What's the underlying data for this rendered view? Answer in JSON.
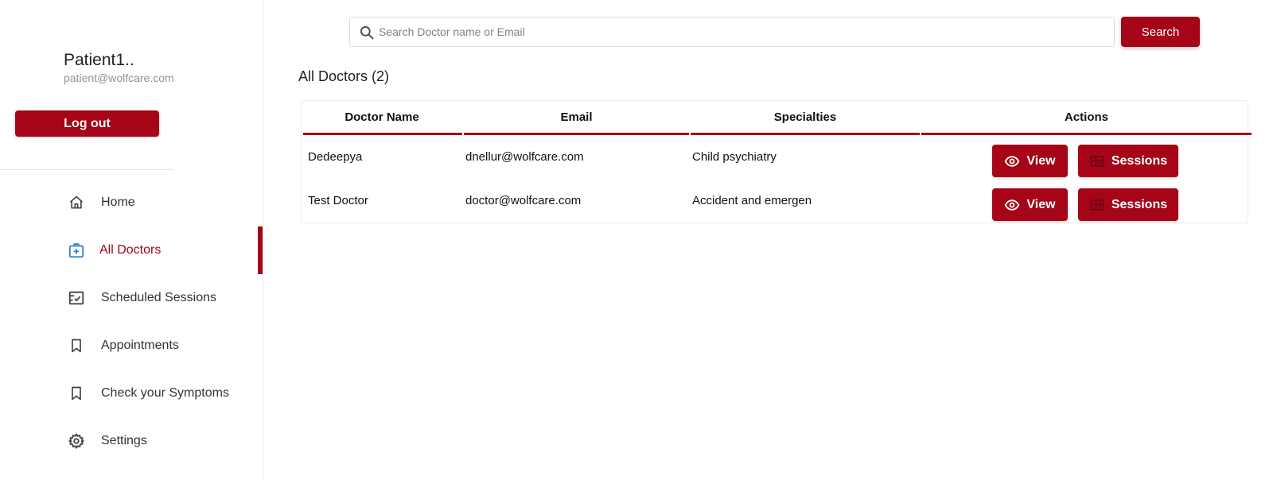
{
  "profile": {
    "name": "Patient1..",
    "email": "patient@wolfcare.com",
    "logout_label": "Log out"
  },
  "nav": {
    "items": [
      {
        "label": "Home",
        "icon": "home-icon"
      },
      {
        "label": "All Doctors",
        "icon": "medical-kit-icon",
        "active": true
      },
      {
        "label": "Scheduled Sessions",
        "icon": "schedule-icon"
      },
      {
        "label": "Appointments",
        "icon": "bookmark-icon"
      },
      {
        "label": "Check your Symptoms",
        "icon": "bookmark-icon"
      },
      {
        "label": "Settings",
        "icon": "gear-icon"
      }
    ]
  },
  "search": {
    "placeholder": "Search Doctor name or Email",
    "value": "",
    "button_label": "Search"
  },
  "section": {
    "title": "All Doctors (2)"
  },
  "table": {
    "columns": [
      "Doctor Name",
      "Email",
      "Specialties",
      "Actions"
    ],
    "rows": [
      {
        "name": "Dedeepya",
        "email": "dnellur@wolfcare.com",
        "specialty": "Child psychiatry",
        "view_label": "View",
        "sessions_label": "Sessions"
      },
      {
        "name": "Test Doctor",
        "email": "doctor@wolfcare.com",
        "specialty": "Accident and emergen",
        "view_label": "View",
        "sessions_label": "Sessions"
      }
    ]
  },
  "colors": {
    "accent": "#a50517",
    "active_icon": "#2d7fd3"
  }
}
